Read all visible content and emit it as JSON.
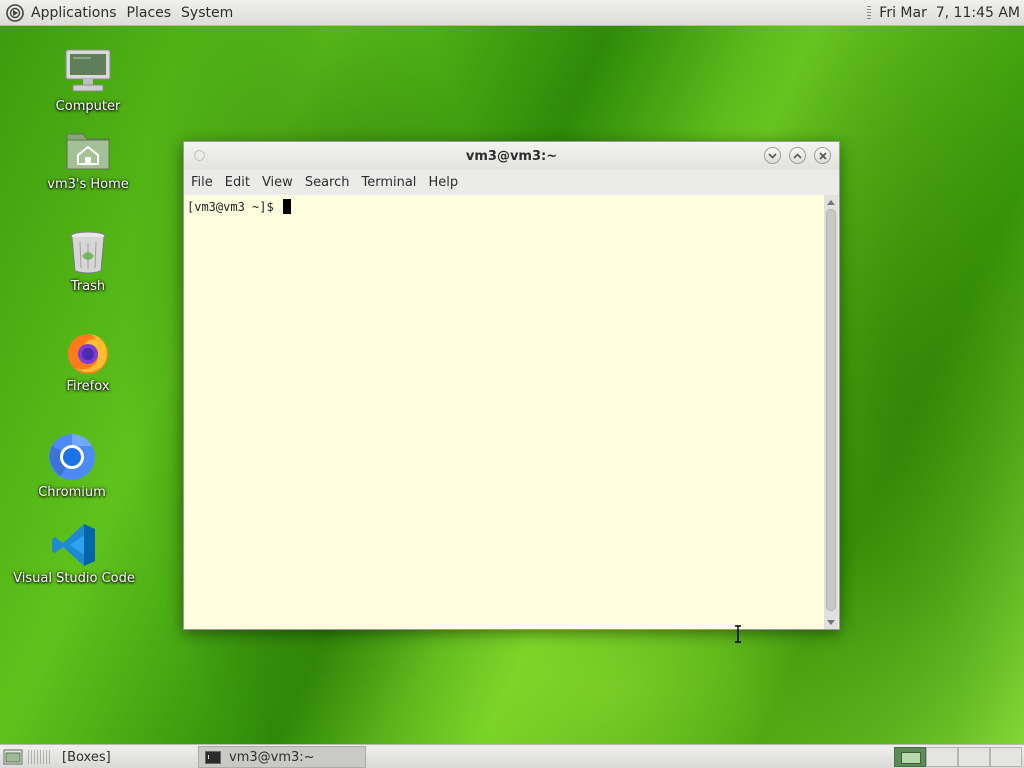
{
  "top_panel": {
    "menus": [
      "Applications",
      "Places",
      "System"
    ],
    "clock": "Fri Mar  7, 11:45 AM"
  },
  "desktop": {
    "icons": [
      {
        "label": "Computer",
        "icon": "computer-icon"
      },
      {
        "label": "vm3's Home",
        "icon": "home-folder-icon"
      },
      {
        "label": "Trash",
        "icon": "trash-icon"
      },
      {
        "label": "Firefox",
        "icon": "firefox-icon"
      },
      {
        "label": "Chromium",
        "icon": "chromium-icon"
      },
      {
        "label": "Visual Studio Code",
        "icon": "vscode-icon"
      }
    ]
  },
  "terminal": {
    "title": "vm3@vm3:~",
    "menu": [
      "File",
      "Edit",
      "View",
      "Search",
      "Terminal",
      "Help"
    ],
    "prompt": "[vm3@vm3 ~]$ ",
    "background": "#ffffe0"
  },
  "bottom_panel": {
    "tasks": [
      {
        "label": "[Boxes]"
      },
      {
        "label": "vm3@vm3:~"
      }
    ],
    "workspace_count": 4,
    "active_workspace": 1
  }
}
